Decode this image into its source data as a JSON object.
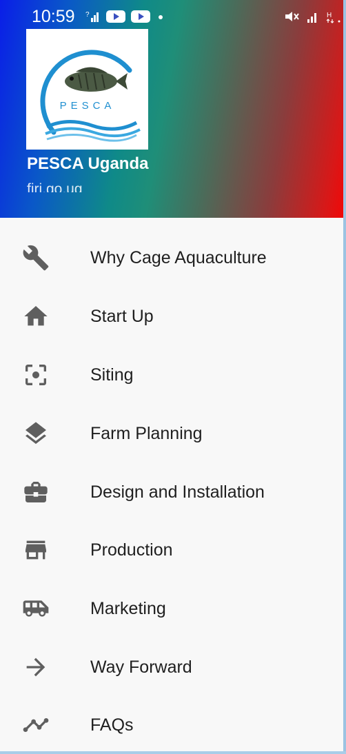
{
  "status_bar": {
    "time": "10:59",
    "left_icons": [
      "data-signal-icon",
      "youtube-icon",
      "youtube-icon",
      "dot-icon"
    ],
    "right_icons": [
      "mute-icon",
      "signal-icon",
      "network-h-icon"
    ]
  },
  "header": {
    "logo_text": "PESCA",
    "app_name": "PESCA Uganda",
    "app_url": "firi.go.ug"
  },
  "menu": {
    "items": [
      {
        "label": "Why Cage Aquaculture",
        "icon": "wrench-icon"
      },
      {
        "label": "Start Up",
        "icon": "home-icon"
      },
      {
        "label": "Siting",
        "icon": "center-focus-icon"
      },
      {
        "label": "Farm Planning",
        "icon": "layers-icon"
      },
      {
        "label": "Design and Installation",
        "icon": "briefcase-icon"
      },
      {
        "label": "Production",
        "icon": "store-icon"
      },
      {
        "label": "Marketing",
        "icon": "van-icon"
      },
      {
        "label": "Way Forward",
        "icon": "arrow-right-icon"
      },
      {
        "label": "FAQs",
        "icon": "trending-icon"
      }
    ]
  },
  "colors": {
    "menu_background": "#f8f8f8",
    "icon_color": "#5f5f5f",
    "label_color": "#1f1f1f"
  }
}
